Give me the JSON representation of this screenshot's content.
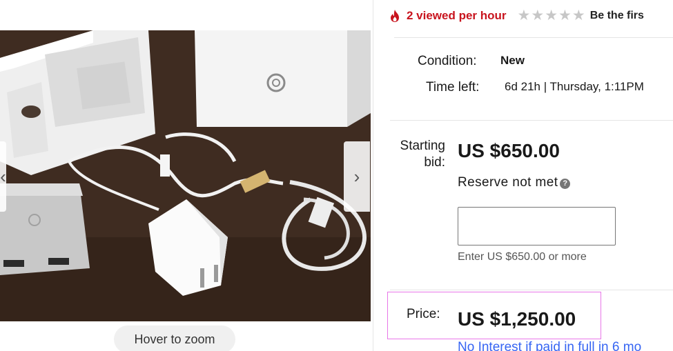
{
  "viewer": {
    "zoom_hint": "Hover to zoom",
    "prev_arrow": "‹",
    "next_arrow": "›"
  },
  "listing": {
    "viewed": "2 viewed per hour",
    "review_prompt": "Be the firs",
    "condition_label": "Condition:",
    "condition_value": "New",
    "time_left_label": "Time left:",
    "time_left_value": "6d 21h | Thursday, 1:11PM",
    "starting_bid_label": "Starting bid:",
    "starting_bid_amount": "US $650.00",
    "reserve_status": "Reserve not met",
    "help_glyph": "?",
    "bid_input_value": "",
    "bid_hint": "Enter US $650.00 or more",
    "price_label": "Price:",
    "price_amount": "US $1,250.00",
    "financing_link": "No Interest if paid in full in 6 mo"
  },
  "icons": {
    "fire": "fire-icon",
    "star": "star-icon",
    "help": "question-circle-icon",
    "chevron_left": "chevron-left-icon",
    "chevron_right": "chevron-right-icon"
  },
  "colors": {
    "viewed_red": "#c8141e",
    "link_blue": "#3665f3",
    "price_highlight": "#e876e8",
    "star_gray": "#c7c7c7"
  }
}
